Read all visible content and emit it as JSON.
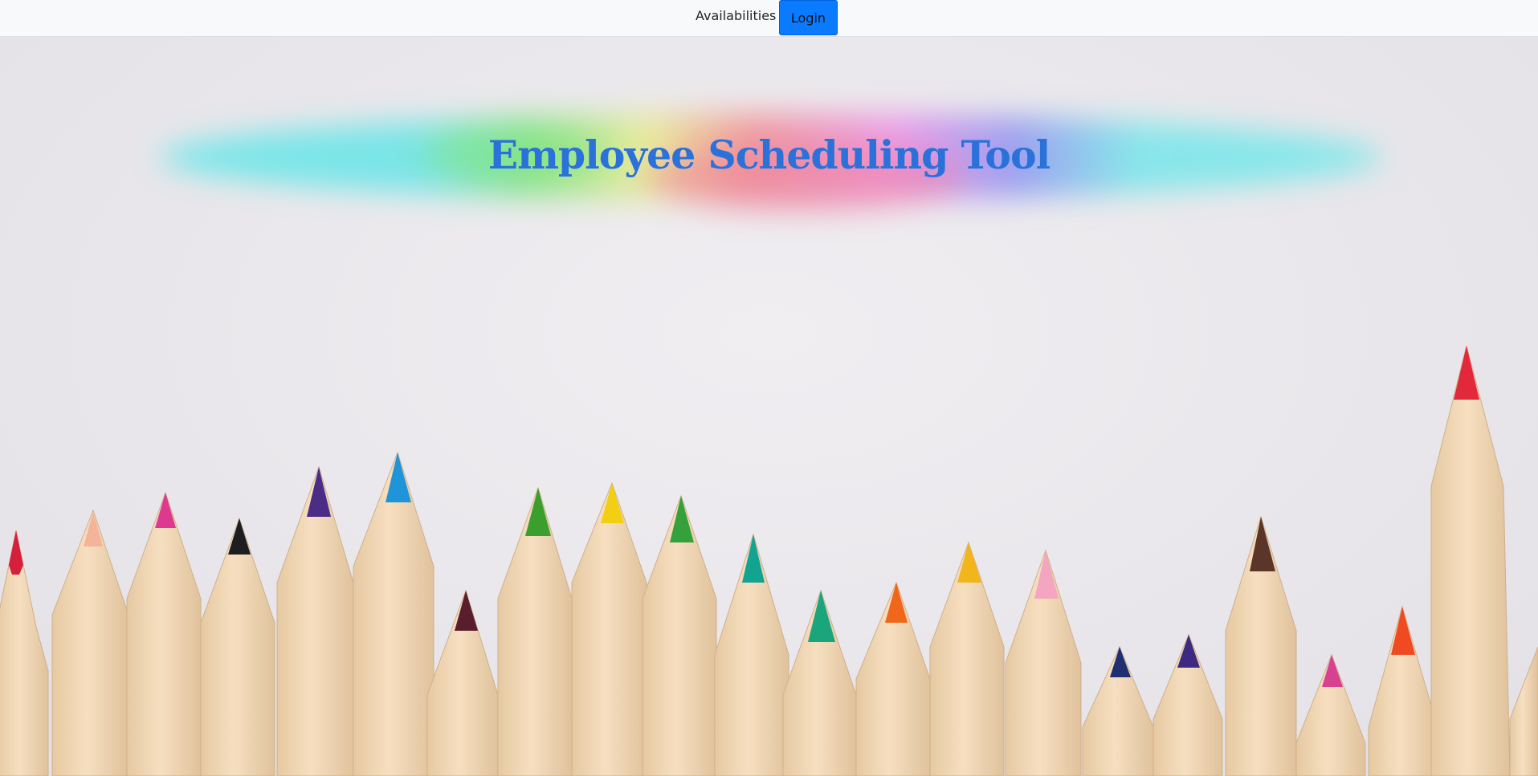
{
  "navbar": {
    "availabilities_label": "Availabilities",
    "login_label": "Login"
  },
  "hero": {
    "title": "Employee Scheduling Tool",
    "title_color": "#2a72d9",
    "background_image": "colored-pencils-illustration",
    "pencil_tip_colors": [
      "#d41f3d",
      "#f4b49a",
      "#dd3a8f",
      "#1e1d22",
      "#4b2d88",
      "#1f94d8",
      "#5a1d2c",
      "#3b9f2e",
      "#f2cf12",
      "#35a13c",
      "#12a391",
      "#1aa57c",
      "#f0661a",
      "#f2b51c",
      "#f4a5bf",
      "#1f2f72",
      "#3c2a82",
      "#5b3528",
      "#d7418f",
      "#ef4a21",
      "#e2283b"
    ]
  },
  "colors": {
    "accent": "#0a7bff",
    "navbar_bg": "#f8f9fa"
  }
}
